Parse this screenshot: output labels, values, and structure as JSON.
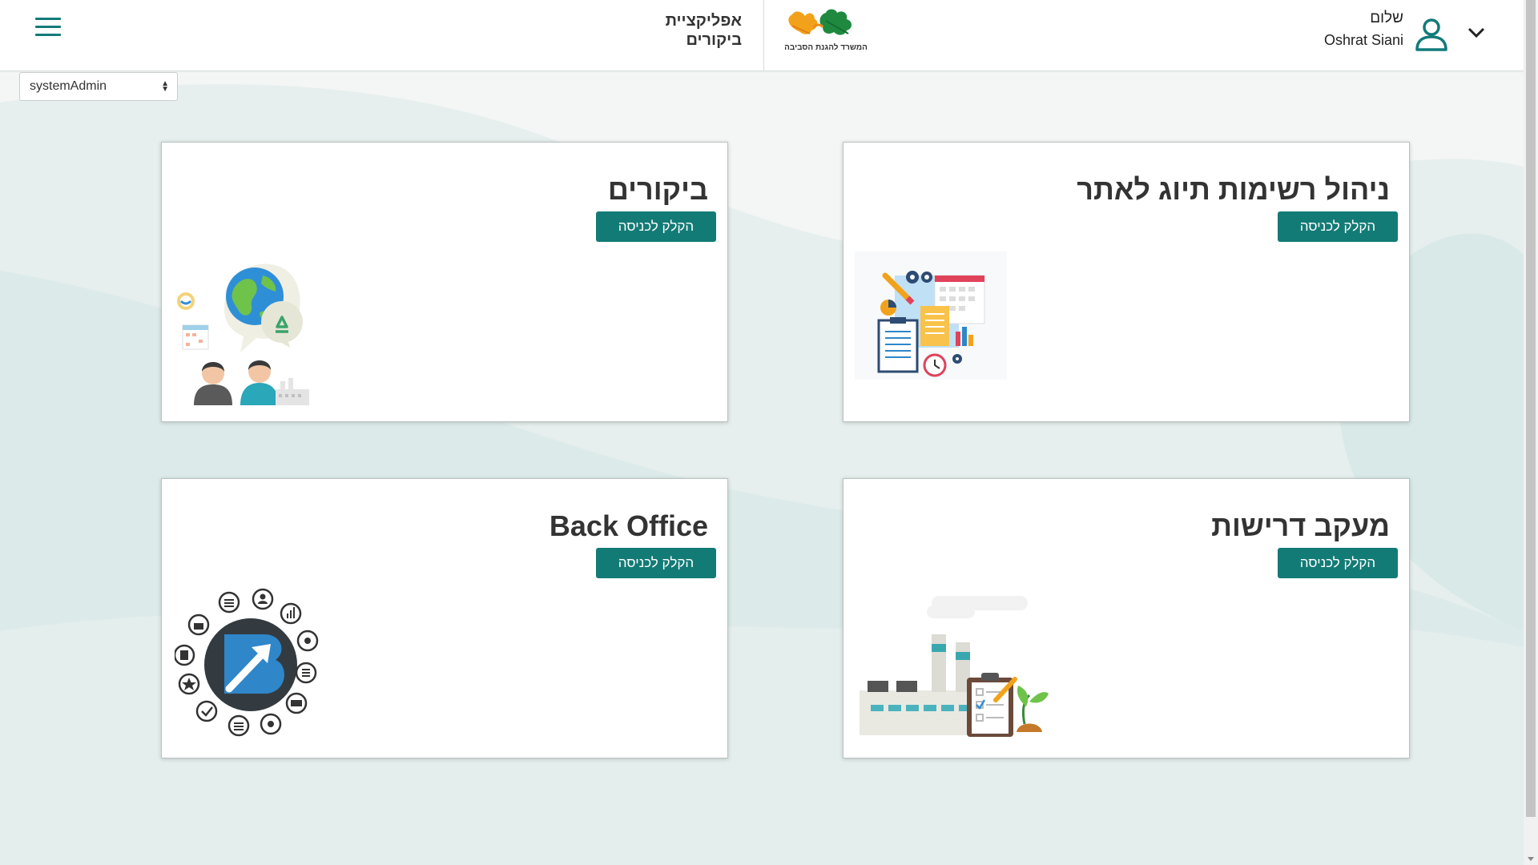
{
  "header": {
    "app_title_line1": "אפליקציית",
    "app_title_line2": "ביקורים",
    "logo_text": "המשרד להגנת הסביבה",
    "greeting": "שלום",
    "user_name": "Oshrat Siani"
  },
  "role_select": {
    "value": "systemAdmin"
  },
  "cards": [
    {
      "title": "ניהול רשימות תיוג לאתר",
      "button": "הקלק לכניסה",
      "illustration": "planning-icon"
    },
    {
      "title": "ביקורים",
      "button": "הקלק לכניסה",
      "illustration": "environment-people-icon"
    },
    {
      "title": "מעקב דרישות",
      "button": "הקלק לכניסה",
      "illustration": "factory-checklist-icon"
    },
    {
      "title": "Back Office",
      "button": "הקלק לכניסה",
      "illustration": "backoffice-logo-icon"
    }
  ],
  "colors": {
    "accent": "#137b76",
    "icon_teal": "#127a7a",
    "background": "#e6efee"
  }
}
